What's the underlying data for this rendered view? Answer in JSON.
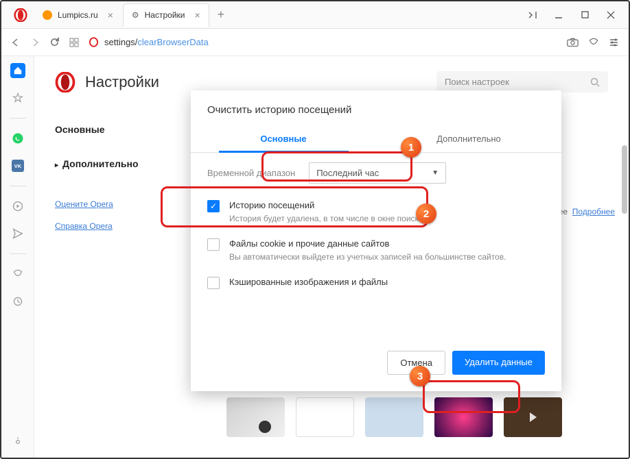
{
  "tabs": [
    {
      "title": "Lumpics.ru",
      "favicon_color": "#ff9500"
    },
    {
      "title": "Настройки",
      "favicon": "gear"
    }
  ],
  "address": {
    "prefix": "settings/",
    "path": "clearBrowserData"
  },
  "settings": {
    "title": "Настройки",
    "search_placeholder": "Поиск настроек",
    "nav_main": "Основные",
    "nav_advanced": "Дополнительно",
    "link_rate": "Оцените Opera",
    "link_help": "Справка Opera",
    "banner_suffix": "аза быстрее",
    "banner_link": "Подробнее"
  },
  "dialog": {
    "title": "Очистить историю посещений",
    "tab_basic": "Основные",
    "tab_advanced": "Дополнительно",
    "range_label": "Временной диапазон",
    "range_value": "Последний час",
    "opts": [
      {
        "title": "Историю посещений",
        "desc": "История будет удалена, в том числе в окне поиска",
        "checked": true
      },
      {
        "title": "Файлы cookie и прочие данные сайтов",
        "desc": "Вы автоматически выйдете из учетных записей на большинстве сайтов.",
        "checked": false
      },
      {
        "title": "Кэшированные изображения и файлы",
        "desc": "",
        "checked": false
      }
    ],
    "cancel": "Отмена",
    "confirm": "Удалить данные"
  },
  "badges": {
    "b1": "1",
    "b2": "2",
    "b3": "3"
  }
}
